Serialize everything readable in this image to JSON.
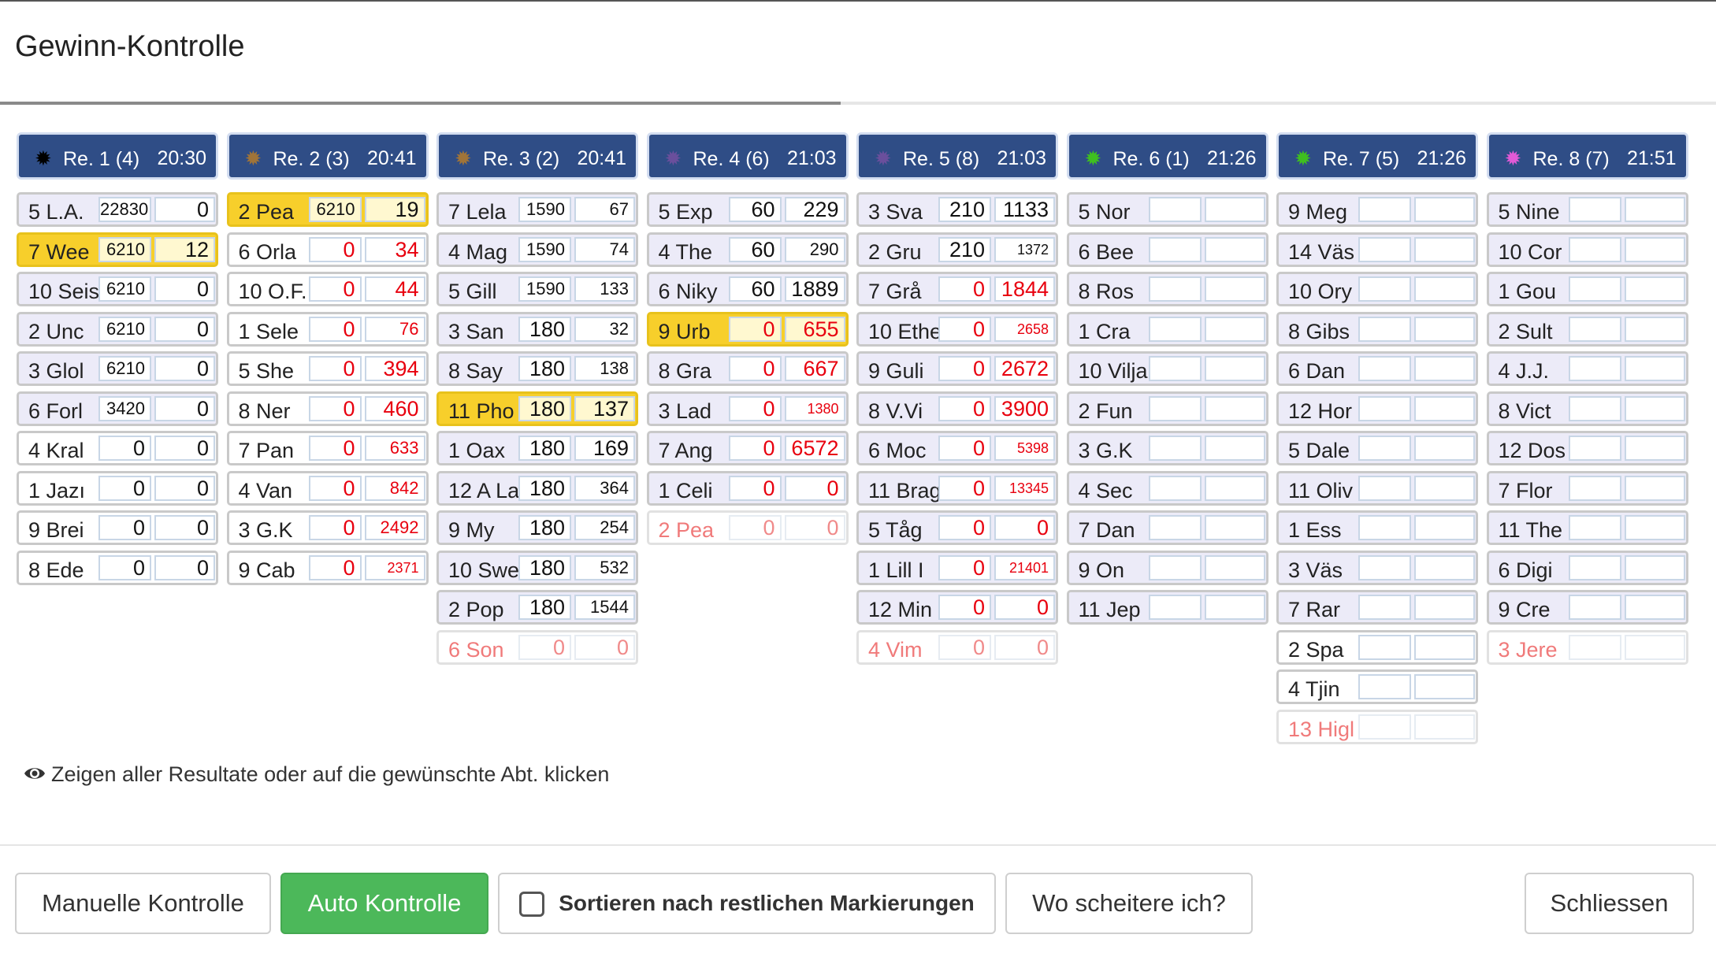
{
  "dialog": {
    "title": "Gewinn-Kontrolle",
    "progress": 0.49
  },
  "colors": {
    "header_bg": "#2f4d86",
    "winner": "#f7cf2b",
    "row_bg": "#ecebf8",
    "red": "#e8000e",
    "green_button": "#4cb85a"
  },
  "races": [
    {
      "label": "Re. 1 (4)",
      "time": "20:30",
      "icon": "burst-icon",
      "icon_color": "#000000",
      "rows": [
        {
          "name": "5 L.A.",
          "v1": "22830",
          "v2": "0",
          "s1": "22",
          "s2": "27",
          "style": "lav"
        },
        {
          "name": "7 Wee",
          "v1": "6210",
          "v2": "12",
          "s1": "22",
          "s2": "27",
          "style": "gold"
        },
        {
          "name": "10 Seis",
          "v1": "6210",
          "v2": "0",
          "s1": "22",
          "s2": "27",
          "style": "lav"
        },
        {
          "name": "2 Unc",
          "v1": "6210",
          "v2": "0",
          "s1": "22",
          "s2": "27",
          "style": "lav"
        },
        {
          "name": "3 Glol",
          "v1": "6210",
          "v2": "0",
          "s1": "22",
          "s2": "27",
          "style": "lav"
        },
        {
          "name": "6 Forl",
          "v1": "3420",
          "v2": "0",
          "s1": "22",
          "s2": "27",
          "style": "lav"
        },
        {
          "name": "4 Kral",
          "v1": "0",
          "v2": "0",
          "s1": "27",
          "s2": "27",
          "style": "white"
        },
        {
          "name": "1 Jazı",
          "v1": "0",
          "v2": "0",
          "s1": "27",
          "s2": "27",
          "style": "white"
        },
        {
          "name": "9 Brei",
          "v1": "0",
          "v2": "0",
          "s1": "27",
          "s2": "27",
          "style": "white"
        },
        {
          "name": "8 Ede",
          "v1": "0",
          "v2": "0",
          "s1": "27",
          "s2": "27",
          "style": "white"
        }
      ]
    },
    {
      "label": "Re. 2 (3)",
      "time": "20:41",
      "icon": "burst-icon",
      "icon_color": "#a07438",
      "rows": [
        {
          "name": "2 Pea",
          "v1": "6210",
          "v2": "19",
          "s1": "22",
          "s2": "27",
          "style": "gold"
        },
        {
          "name": "6 Orla",
          "v1": "0",
          "v2": "34",
          "s1": "27",
          "s2": "27",
          "style": "white",
          "red": true
        },
        {
          "name": "10 O.F.",
          "v1": "0",
          "v2": "44",
          "s1": "27",
          "s2": "27",
          "style": "white",
          "red": true
        },
        {
          "name": "1 Sele",
          "v1": "0",
          "v2": "76",
          "s1": "27",
          "s2": "22",
          "style": "white",
          "red": true
        },
        {
          "name": "5 She",
          "v1": "0",
          "v2": "394",
          "s1": "27",
          "s2": "27",
          "style": "white",
          "red": true
        },
        {
          "name": "8 Ner",
          "v1": "0",
          "v2": "460",
          "s1": "27",
          "s2": "27",
          "style": "white",
          "red": true
        },
        {
          "name": "7 Pan",
          "v1": "0",
          "v2": "633",
          "s1": "27",
          "s2": "22",
          "style": "white",
          "red": true
        },
        {
          "name": "4 Van",
          "v1": "0",
          "v2": "842",
          "s1": "27",
          "s2": "22",
          "style": "white",
          "red": true
        },
        {
          "name": "3 G.K",
          "v1": "0",
          "v2": "2492",
          "s1": "27",
          "s2": "22",
          "style": "white",
          "red": true
        },
        {
          "name": "9 Cab",
          "v1": "0",
          "v2": "2371",
          "s1": "27",
          "s2": "18",
          "style": "white",
          "red": true
        }
      ]
    },
    {
      "label": "Re. 3 (2)",
      "time": "20:41",
      "icon": "burst-icon",
      "icon_color": "#a07438",
      "rows": [
        {
          "name": "7 Lela",
          "v1": "1590",
          "v2": "67",
          "s1": "22",
          "s2": "22",
          "style": "lav"
        },
        {
          "name": "4 Mag",
          "v1": "1590",
          "v2": "74",
          "s1": "22",
          "s2": "22",
          "style": "lav"
        },
        {
          "name": "5 Gill",
          "v1": "1590",
          "v2": "133",
          "s1": "22",
          "s2": "22",
          "style": "lav"
        },
        {
          "name": "3 San",
          "v1": "180",
          "v2": "32",
          "s1": "27",
          "s2": "22",
          "style": "lav"
        },
        {
          "name": "8 Say",
          "v1": "180",
          "v2": "138",
          "s1": "27",
          "s2": "22",
          "style": "lav"
        },
        {
          "name": "11 Pho",
          "v1": "180",
          "v2": "137",
          "s1": "27",
          "s2": "27",
          "style": "gold"
        },
        {
          "name": "1 Oax",
          "v1": "180",
          "v2": "169",
          "s1": "27",
          "s2": "27",
          "style": "lav"
        },
        {
          "name": "12 A La",
          "v1": "180",
          "v2": "364",
          "s1": "27",
          "s2": "22",
          "style": "lav"
        },
        {
          "name": "9 My",
          "v1": "180",
          "v2": "254",
          "s1": "27",
          "s2": "22",
          "style": "lav"
        },
        {
          "name": "10 Swe",
          "v1": "180",
          "v2": "532",
          "s1": "27",
          "s2": "22",
          "style": "lav"
        },
        {
          "name": "2 Pop",
          "v1": "180",
          "v2": "1544",
          "s1": "27",
          "s2": "22",
          "style": "lav"
        },
        {
          "name": "6 Son",
          "v1": "0",
          "v2": "0",
          "s1": "27",
          "s2": "27",
          "style": "faded"
        }
      ]
    },
    {
      "label": "Re. 4 (6)",
      "time": "21:03",
      "icon": "burst-icon",
      "icon_color": "#6a4f9c",
      "rows": [
        {
          "name": "5 Exp",
          "v1": "60",
          "v2": "229",
          "s1": "27",
          "s2": "27",
          "style": "lav"
        },
        {
          "name": "4 The",
          "v1": "60",
          "v2": "290",
          "s1": "27",
          "s2": "22",
          "style": "lav"
        },
        {
          "name": "6 Niky",
          "v1": "60",
          "v2": "1889",
          "s1": "27",
          "s2": "27",
          "style": "lav"
        },
        {
          "name": "9 Urb",
          "v1": "0",
          "v2": "655",
          "s1": "27",
          "s2": "27",
          "style": "gold",
          "red": true
        },
        {
          "name": "8 Gra",
          "v1": "0",
          "v2": "667",
          "s1": "27",
          "s2": "27",
          "style": "lav",
          "red": true
        },
        {
          "name": "3 Lad",
          "v1": "0",
          "v2": "1380",
          "s1": "27",
          "s2": "18",
          "style": "lav",
          "red": true
        },
        {
          "name": "7 Ang",
          "v1": "0",
          "v2": "6572",
          "s1": "27",
          "s2": "27",
          "style": "lav",
          "red": true
        },
        {
          "name": "1 Celi",
          "v1": "0",
          "v2": "0",
          "s1": "27",
          "s2": "27",
          "style": "lav",
          "red": true
        },
        {
          "name": "2 Pea",
          "v1": "0",
          "v2": "0",
          "s1": "27",
          "s2": "27",
          "style": "faded"
        }
      ]
    },
    {
      "label": "Re. 5 (8)",
      "time": "21:03",
      "icon": "burst-icon",
      "icon_color": "#6a4f9c",
      "rows": [
        {
          "name": "3 Sva",
          "v1": "210",
          "v2": "1133",
          "s1": "27",
          "s2": "27",
          "style": "lav"
        },
        {
          "name": "2 Gru",
          "v1": "210",
          "v2": "1372",
          "s1": "27",
          "s2": "18",
          "style": "lav"
        },
        {
          "name": "7 Grå",
          "v1": "0",
          "v2": "1844",
          "s1": "27",
          "s2": "27",
          "style": "lav",
          "red": true
        },
        {
          "name": "10 Ethe",
          "v1": "0",
          "v2": "2658",
          "s1": "27",
          "s2": "18",
          "style": "lav",
          "red": true
        },
        {
          "name": "9 Guli",
          "v1": "0",
          "v2": "2672",
          "s1": "27",
          "s2": "27",
          "style": "lav",
          "red": true
        },
        {
          "name": "8 V.Vi",
          "v1": "0",
          "v2": "3900",
          "s1": "27",
          "s2": "27",
          "style": "lav",
          "red": true
        },
        {
          "name": "6 Moc",
          "v1": "0",
          "v2": "5398",
          "s1": "27",
          "s2": "18",
          "style": "lav",
          "red": true
        },
        {
          "name": "11 Brag",
          "v1": "0",
          "v2": "13345",
          "s1": "27",
          "s2": "18",
          "style": "lav",
          "red": true
        },
        {
          "name": "5 Tåg",
          "v1": "0",
          "v2": "0",
          "s1": "27",
          "s2": "27",
          "style": "lav",
          "red": true
        },
        {
          "name": "1 Lill I",
          "v1": "0",
          "v2": "21401",
          "s1": "27",
          "s2": "18",
          "style": "lav",
          "red": true
        },
        {
          "name": "12 Min",
          "v1": "0",
          "v2": "0",
          "s1": "27",
          "s2": "27",
          "style": "lav",
          "red": true
        },
        {
          "name": "4 Vim",
          "v1": "0",
          "v2": "0",
          "s1": "27",
          "s2": "27",
          "style": "faded"
        }
      ]
    },
    {
      "label": "Re. 6 (1)",
      "time": "21:26",
      "icon": "burst-icon",
      "icon_color": "#3fbf1f",
      "rows": [
        {
          "name": "5 Nor",
          "v1": "",
          "v2": "",
          "style": "lav"
        },
        {
          "name": "6 Bee",
          "v1": "",
          "v2": "",
          "style": "lav"
        },
        {
          "name": "8 Ros",
          "v1": "",
          "v2": "",
          "style": "lav"
        },
        {
          "name": "1 Cra",
          "v1": "",
          "v2": "",
          "style": "lav"
        },
        {
          "name": "10 Vilja",
          "v1": "",
          "v2": "",
          "style": "lav"
        },
        {
          "name": "2 Fun",
          "v1": "",
          "v2": "",
          "style": "lav"
        },
        {
          "name": "3 G.K",
          "v1": "",
          "v2": "",
          "style": "lav"
        },
        {
          "name": "4 Sec",
          "v1": "",
          "v2": "",
          "style": "lav"
        },
        {
          "name": "7 Dan",
          "v1": "",
          "v2": "",
          "style": "lav"
        },
        {
          "name": "9 On",
          "v1": "",
          "v2": "",
          "style": "lav"
        },
        {
          "name": "11 Jep",
          "v1": "",
          "v2": "",
          "style": "lav"
        }
      ]
    },
    {
      "label": "Re. 7 (5)",
      "time": "21:26",
      "icon": "burst-icon",
      "icon_color": "#3fbf1f",
      "rows": [
        {
          "name": "9 Meg",
          "v1": "",
          "v2": "",
          "style": "lav"
        },
        {
          "name": "14 Väs",
          "v1": "",
          "v2": "",
          "style": "lav"
        },
        {
          "name": "10 Ory",
          "v1": "",
          "v2": "",
          "style": "lav"
        },
        {
          "name": "8 Gibs",
          "v1": "",
          "v2": "",
          "style": "lav"
        },
        {
          "name": "6 Dan",
          "v1": "",
          "v2": "",
          "style": "lav"
        },
        {
          "name": "12 Hor",
          "v1": "",
          "v2": "",
          "style": "lav"
        },
        {
          "name": "5 Dale",
          "v1": "",
          "v2": "",
          "style": "lav"
        },
        {
          "name": "11 Oliv",
          "v1": "",
          "v2": "",
          "style": "lav"
        },
        {
          "name": "1 Ess",
          "v1": "",
          "v2": "",
          "style": "lav"
        },
        {
          "name": "3 Väs",
          "v1": "",
          "v2": "",
          "style": "lav"
        },
        {
          "name": "7 Rar",
          "v1": "",
          "v2": "",
          "style": "lav"
        },
        {
          "name": "2 Spa",
          "v1": "",
          "v2": "",
          "style": "white"
        },
        {
          "name": "4 Tjin",
          "v1": "",
          "v2": "",
          "style": "white"
        },
        {
          "name": "13 Higl",
          "v1": "",
          "v2": "",
          "style": "faded"
        }
      ]
    },
    {
      "label": "Re. 8 (7)",
      "time": "21:51",
      "icon": "burst-icon",
      "icon_color": "#e25ad6",
      "rows": [
        {
          "name": "5 Nine",
          "v1": "",
          "v2": "",
          "style": "lav"
        },
        {
          "name": "10 Cor",
          "v1": "",
          "v2": "",
          "style": "lav"
        },
        {
          "name": "1 Gou",
          "v1": "",
          "v2": "",
          "style": "lav"
        },
        {
          "name": "2 Sult",
          "v1": "",
          "v2": "",
          "style": "lav"
        },
        {
          "name": "4 J.J.",
          "v1": "",
          "v2": "",
          "style": "lav"
        },
        {
          "name": "8 Vict",
          "v1": "",
          "v2": "",
          "style": "lav"
        },
        {
          "name": "12 Dos",
          "v1": "",
          "v2": "",
          "style": "lav"
        },
        {
          "name": "7 Flor",
          "v1": "",
          "v2": "",
          "style": "lav"
        },
        {
          "name": "11 The",
          "v1": "",
          "v2": "",
          "style": "lav"
        },
        {
          "name": "6 Digi",
          "v1": "",
          "v2": "",
          "style": "lav"
        },
        {
          "name": "9 Cre",
          "v1": "",
          "v2": "",
          "style": "lav"
        },
        {
          "name": "3 Jere",
          "v1": "",
          "v2": "",
          "style": "faded"
        }
      ]
    }
  ],
  "hint": {
    "icon": "eye-icon",
    "text": "Zeigen aller Resultate oder auf die gewünschte Abt. klicken"
  },
  "footer": {
    "manual": "Manuelle Kontrolle",
    "auto": "Auto Kontrolle",
    "sort": "Sortieren nach restlichen Markierungen",
    "where": "Wo scheitere ich?",
    "close": "Schliessen"
  }
}
